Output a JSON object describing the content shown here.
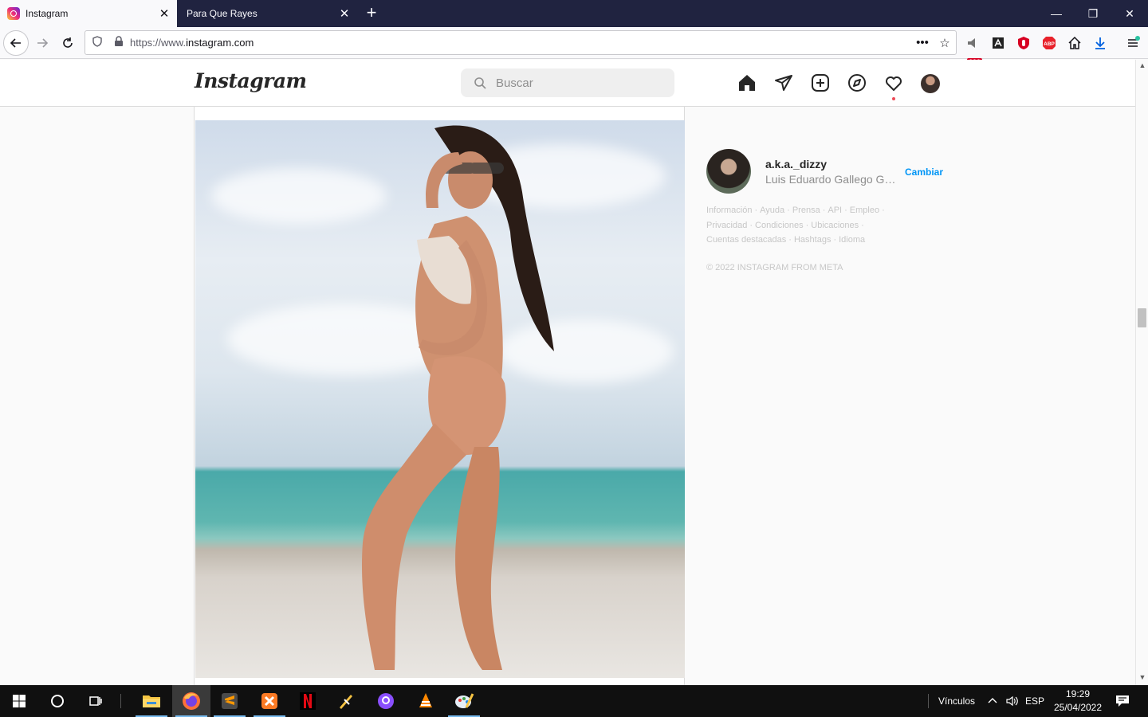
{
  "browser": {
    "tabs": [
      {
        "title": "Instagram",
        "active": true
      },
      {
        "title": "Para Que Rayes",
        "active": false
      }
    ],
    "url_prefix": "https://www.",
    "url_domain": "instagram.com",
    "blocked_badge": "600",
    "abp_label": "ABP"
  },
  "instagram": {
    "logo": "Instagram",
    "search_placeholder": "Buscar",
    "nav_icons": [
      "home-icon",
      "direct-icon",
      "new-post-icon",
      "explore-icon",
      "activity-icon",
      "profile-avatar"
    ],
    "notification_dot_color": "#ed4956"
  },
  "sidebar": {
    "username": "a.k.a._dizzy",
    "full_name": "Luis Eduardo Gallego Gar...",
    "switch_label": "Cambiar",
    "footer_links": [
      "Información",
      "Ayuda",
      "Prensa",
      "API",
      "Empleo",
      "Privacidad",
      "Condiciones",
      "Ubicaciones",
      "Cuentas destacadas",
      "Hashtags",
      "Idioma"
    ],
    "copyright": "© 2022 INSTAGRAM FROM META"
  },
  "taskbar": {
    "apps": [
      "file-explorer-icon",
      "firefox-icon",
      "sublime-text-icon",
      "xampp-icon",
      "netflix-icon",
      "app-icon",
      "github-desktop-icon",
      "vlc-icon",
      "paint-icon"
    ],
    "links_label": "Vínculos",
    "language": "ESP",
    "time": "19:29",
    "date": "25/04/2022"
  },
  "colors": {
    "accent": "#0095f6",
    "taskbar": "#101010",
    "tabstrip": "#202340"
  }
}
